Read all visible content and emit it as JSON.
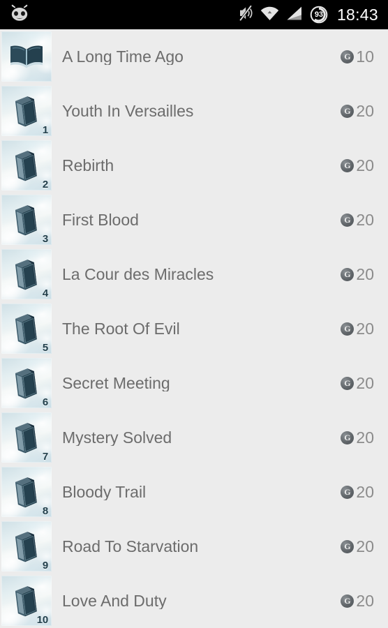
{
  "statusbar": {
    "logo_icon": "cyanogenmod-cid-icon",
    "icons": [
      {
        "name": "mute-icon",
        "label": "Silent mode"
      },
      {
        "name": "wifi-icon",
        "label": "Wi-Fi"
      },
      {
        "name": "cellular-signal-icon",
        "label": "Signal"
      },
      {
        "name": "battery-icon",
        "label": "Battery"
      }
    ],
    "battery_level": "93",
    "clock": "18:43"
  },
  "theme": {
    "background": "#ECECEC",
    "statusbar_background": "#000000",
    "title_color": "#6C6C6C",
    "score_color": "#8B8B8B",
    "chip_color": "#5F6468",
    "thumb_book_color": "#2B4654"
  },
  "list": {
    "name": "chapter-list",
    "items": [
      {
        "title": "A Long Time Ago",
        "thumb_icon": "open-book-icon",
        "thumb_badge": "",
        "score": "10",
        "score_icon": "g-coin-icon"
      },
      {
        "title": "Youth In Versailles",
        "thumb_icon": "closed-book-icon",
        "thumb_badge": "1",
        "score": "20",
        "score_icon": "g-coin-icon"
      },
      {
        "title": "Rebirth",
        "thumb_icon": "closed-book-icon",
        "thumb_badge": "2",
        "score": "20",
        "score_icon": "g-coin-icon"
      },
      {
        "title": "First Blood",
        "thumb_icon": "closed-book-icon",
        "thumb_badge": "3",
        "score": "20",
        "score_icon": "g-coin-icon"
      },
      {
        "title": "La Cour des Miracles",
        "thumb_icon": "closed-book-icon",
        "thumb_badge": "4",
        "score": "20",
        "score_icon": "g-coin-icon"
      },
      {
        "title": "The Root Of Evil",
        "thumb_icon": "closed-book-icon",
        "thumb_badge": "5",
        "score": "20",
        "score_icon": "g-coin-icon"
      },
      {
        "title": "Secret Meeting",
        "thumb_icon": "closed-book-icon",
        "thumb_badge": "6",
        "score": "20",
        "score_icon": "g-coin-icon"
      },
      {
        "title": "Mystery Solved",
        "thumb_icon": "closed-book-icon",
        "thumb_badge": "7",
        "score": "20",
        "score_icon": "g-coin-icon"
      },
      {
        "title": "Bloody Trail",
        "thumb_icon": "closed-book-icon",
        "thumb_badge": "8",
        "score": "20",
        "score_icon": "g-coin-icon"
      },
      {
        "title": "Road To Starvation",
        "thumb_icon": "closed-book-icon",
        "thumb_badge": "9",
        "score": "20",
        "score_icon": "g-coin-icon"
      },
      {
        "title": "Love And Duty",
        "thumb_icon": "closed-book-icon",
        "thumb_badge": "10",
        "score": "20",
        "score_icon": "g-coin-icon"
      }
    ]
  }
}
